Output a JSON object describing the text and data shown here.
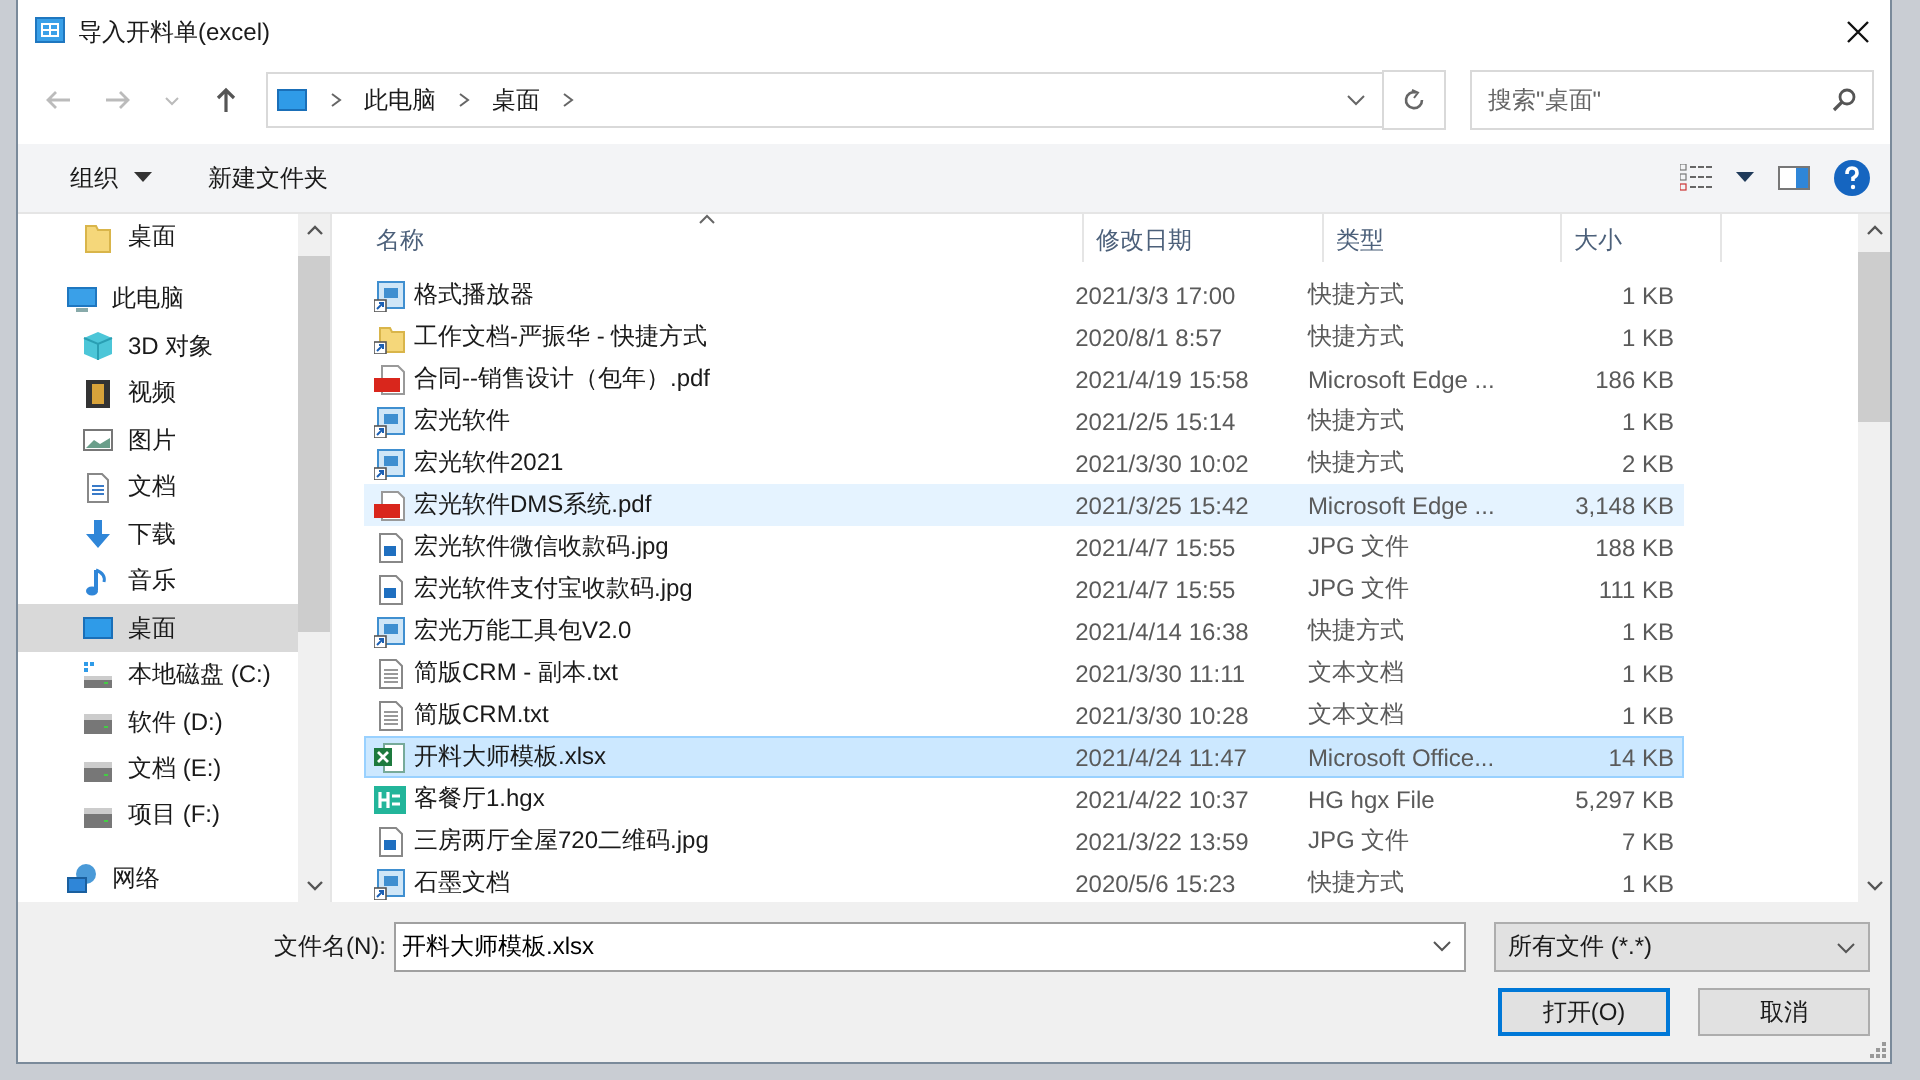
{
  "window": {
    "title": "导入开料单(excel)"
  },
  "nav": {
    "breadcrumb": [
      "此电脑",
      "桌面"
    ],
    "search": {
      "placeholder": "搜索\"桌面\""
    }
  },
  "toolbar": {
    "organize": "组织",
    "new_folder": "新建文件夹"
  },
  "sidebar": {
    "items": [
      {
        "label": "桌面",
        "kind": "folder",
        "selected": false
      },
      {
        "label": "此电脑",
        "kind": "pc",
        "selected": false,
        "children": [
          {
            "label": "3D 对象",
            "kind": "cube",
            "selected": false
          },
          {
            "label": "视频",
            "kind": "video",
            "selected": false
          },
          {
            "label": "图片",
            "kind": "pictures",
            "selected": false
          },
          {
            "label": "文档",
            "kind": "docs",
            "selected": false
          },
          {
            "label": "下载",
            "kind": "download",
            "selected": false
          },
          {
            "label": "音乐",
            "kind": "music",
            "selected": false
          },
          {
            "label": "桌面",
            "kind": "desktop",
            "selected": true
          },
          {
            "label": "本地磁盘 (C:)",
            "kind": "sysdrive",
            "selected": false
          },
          {
            "label": "软件 (D:)",
            "kind": "drive",
            "selected": false
          },
          {
            "label": "文档 (E:)",
            "kind": "drive",
            "selected": false
          },
          {
            "label": "项目 (F:)",
            "kind": "drive",
            "selected": false
          }
        ]
      },
      {
        "label": "网络",
        "kind": "network",
        "selected": false
      }
    ]
  },
  "table": {
    "columns": [
      "名称",
      "修改日期",
      "类型",
      "大小"
    ],
    "rows": [
      {
        "kind": "app",
        "name": "格式播放器",
        "date": "2021/3/3 17:00",
        "type": "快捷方式",
        "size": "1 KB",
        "selected": false,
        "hovered": false
      },
      {
        "kind": "folder-link",
        "name": "工作文档-严振华 - 快捷方式",
        "date": "2020/8/1 8:57",
        "type": "快捷方式",
        "size": "1 KB",
        "selected": false,
        "hovered": false
      },
      {
        "kind": "pdf",
        "name": "合同--销售设计（包年）.pdf",
        "date": "2021/4/19 15:58",
        "type": "Microsoft Edge ...",
        "size": "186 KB",
        "selected": false,
        "hovered": false
      },
      {
        "kind": "app",
        "name": "宏光软件",
        "date": "2021/2/5 15:14",
        "type": "快捷方式",
        "size": "1 KB",
        "selected": false,
        "hovered": false
      },
      {
        "kind": "app",
        "name": "宏光软件2021",
        "date": "2021/3/30 10:02",
        "type": "快捷方式",
        "size": "2 KB",
        "selected": false,
        "hovered": false
      },
      {
        "kind": "pdf",
        "name": "宏光软件DMS系统.pdf",
        "date": "2021/3/25 15:42",
        "type": "Microsoft Edge ...",
        "size": "3,148 KB",
        "selected": false,
        "hovered": true
      },
      {
        "kind": "image",
        "name": "宏光软件微信收款码.jpg",
        "date": "2021/4/7 15:55",
        "type": "JPG 文件",
        "size": "188 KB",
        "selected": false,
        "hovered": false
      },
      {
        "kind": "image",
        "name": "宏光软件支付宝收款码.jpg",
        "date": "2021/4/7 15:55",
        "type": "JPG 文件",
        "size": "111 KB",
        "selected": false,
        "hovered": false
      },
      {
        "kind": "app",
        "name": "宏光万能工具包V2.0",
        "date": "2021/4/14 16:38",
        "type": "快捷方式",
        "size": "1 KB",
        "selected": false,
        "hovered": false
      },
      {
        "kind": "text",
        "name": "简版CRM - 副本.txt",
        "date": "2021/3/30 11:11",
        "type": "文本文档",
        "size": "1 KB",
        "selected": false,
        "hovered": false
      },
      {
        "kind": "text",
        "name": "简版CRM.txt",
        "date": "2021/3/30 10:28",
        "type": "文本文档",
        "size": "1 KB",
        "selected": false,
        "hovered": false
      },
      {
        "kind": "excel",
        "name": "开料大师模板.xlsx",
        "date": "2021/4/24 11:47",
        "type": "Microsoft Office...",
        "size": "14 KB",
        "selected": true,
        "hovered": false
      },
      {
        "kind": "hgx",
        "name": "客餐厅1.hgx",
        "date": "2021/4/22 10:37",
        "type": "HG hgx File",
        "size": "5,297 KB",
        "selected": false,
        "hovered": false
      },
      {
        "kind": "image",
        "name": "三房两厅全屋720二维码.jpg",
        "date": "2021/3/22 13:59",
        "type": "JPG 文件",
        "size": "7 KB",
        "selected": false,
        "hovered": false
      },
      {
        "kind": "app",
        "name": "石墨文档",
        "date": "2020/5/6 15:23",
        "type": "快捷方式",
        "size": "1 KB",
        "selected": false,
        "hovered": false
      }
    ]
  },
  "footer": {
    "filename_label": "文件名(N):",
    "filename": "开料大师模板.xlsx",
    "filter": "所有文件 (*.*)",
    "buttons": [
      {
        "label": "打开(O)",
        "kind": "primary"
      },
      {
        "label": "取消",
        "kind": "normal"
      }
    ]
  }
}
